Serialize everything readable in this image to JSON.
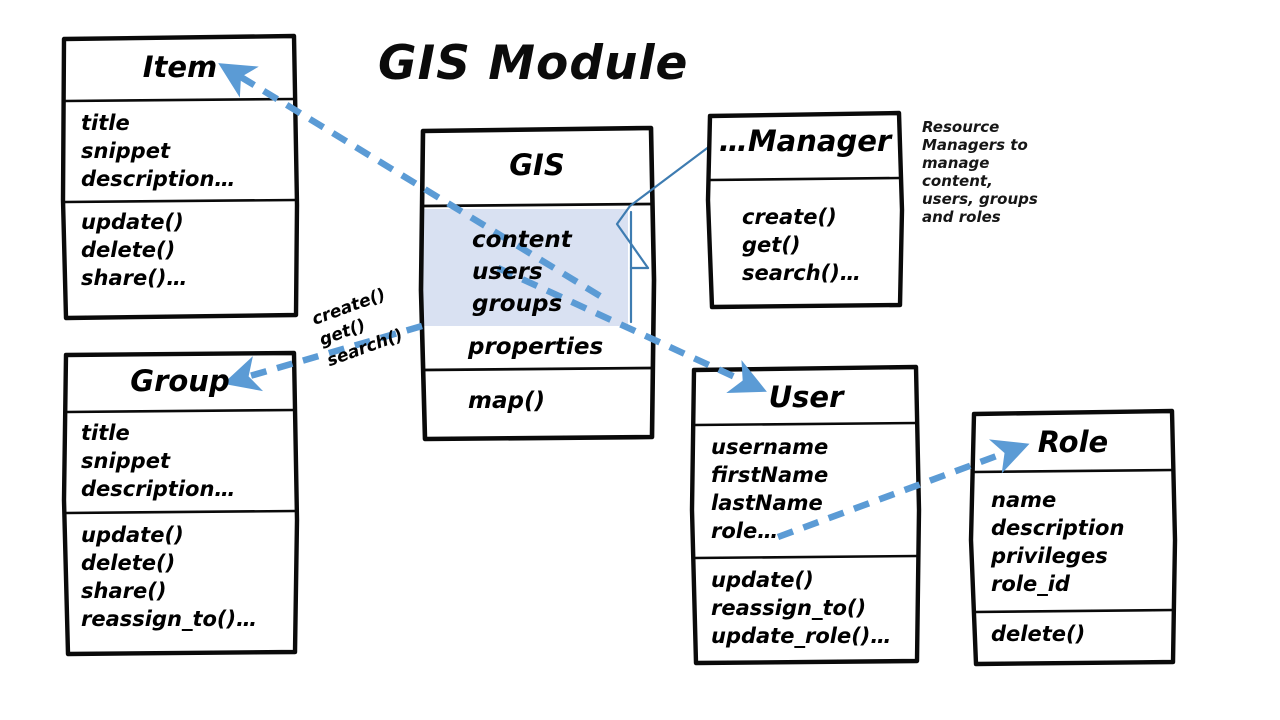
{
  "diagram": {
    "title": "GIS Module",
    "accent_color": "#5b9bd5",
    "highlight_color": "#d9e1f2",
    "connector_color": "#3e7cb1",
    "stroke_color": "#000000"
  },
  "classes": {
    "item": {
      "name": "Item",
      "attributes": "title\nsnippet\ndescription…",
      "methods": "update()\ndelete()\nshare()…"
    },
    "gis": {
      "name": "GIS",
      "highlighted_attributes": "content\nusers\ngroups",
      "attributes": "properties",
      "methods": "map()"
    },
    "manager": {
      "name": "…Manager",
      "methods": "create()\nget()\nsearch()…"
    },
    "group": {
      "name": "Group",
      "attributes": "title\nsnippet\ndescription…",
      "methods": "update()\ndelete()\nshare()\nreassign_to()…"
    },
    "user": {
      "name": "User",
      "attributes": "username\nfirstName\nlastName\nrole…",
      "methods": "update()\nreassign_to()\nupdate_role()…"
    },
    "role": {
      "name": "Role",
      "attributes": "name\ndescription\nprivileges\nrole_id",
      "methods": "delete()"
    }
  },
  "annotations": {
    "resource_managers_note": "Resource Managers to manage content, users, groups and roles",
    "edge_label_gis_group": "create()\nget()\nsearch()"
  }
}
